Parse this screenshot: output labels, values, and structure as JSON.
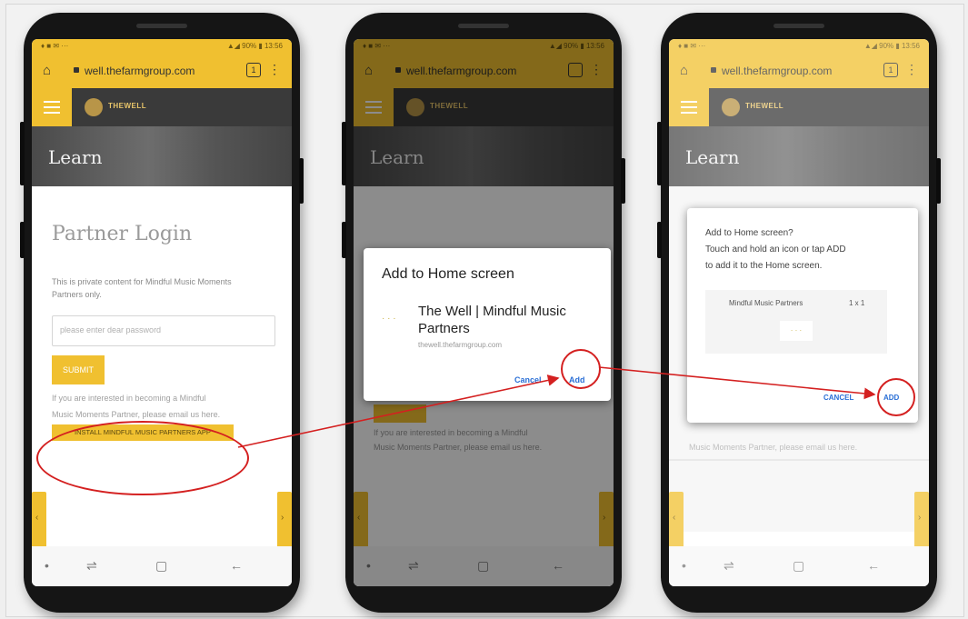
{
  "phones": [
    {
      "status_left": "♦ ■ ✉ ···",
      "status_right": "▲◢ 90% ▮ 13:56",
      "url": "well.thefarmgroup.com",
      "tab_count": "1",
      "brand": "THEWELL",
      "hero_title": "Learn",
      "login": {
        "title": "Partner Login",
        "description": "This is private content for Mindful Music Moments Partners only.",
        "password_placeholder": "please enter dear password",
        "submit": "SUBMIT",
        "info_line1": "If you are interested in becoming a Mindful",
        "info_line2": "Music Moments Partner, please email us here.",
        "install_button": "INSTALL MINDFUL MUSIC PARTNERS APP"
      }
    },
    {
      "status_left": "♦ ■ ✉ ···",
      "status_right": "▲◢ 90% ▮ 13:56",
      "url": "well.thefarmgroup.com",
      "brand": "THEWELL",
      "hero_title": "Learn",
      "dialog": {
        "title": "Add to Home screen",
        "app_name": "The Well | Mindful Music Partners",
        "app_url": "thewell.thefarmgroup.com",
        "cancel": "Cancel",
        "add": "Add"
      },
      "info_line1": "If you are interested in becoming a Mindful",
      "info_line2": "Music Moments Partner, please email us here."
    },
    {
      "status_left": "♦ ■ ✉ ···",
      "status_right": "▲◢ 90% ▮ 13:56",
      "url": "well.thefarmgroup.com",
      "tab_count": "1",
      "brand": "THEWELL",
      "hero_title": "Learn",
      "dialog": {
        "text_line1": "Add to Home screen?",
        "text_line2": "Touch and hold an icon or tap ADD",
        "text_line3": "to add it to the Home screen.",
        "widget_name": "Mindful Music Partners",
        "widget_size": "1 x 1",
        "cancel": "CANCEL",
        "add": "ADD"
      },
      "info_line": "Music Moments Partner, please email us here."
    }
  ],
  "navbar": {
    "dot": "•",
    "recent": "⇌",
    "home": "▢",
    "back": "←"
  },
  "colors": {
    "accent_yellow": "#f0c030",
    "annotation_red": "#d42020",
    "site_dark": "#3a3a3a"
  },
  "icons": {
    "home": "home-icon",
    "lock": "lock-icon",
    "menu": "hamburger-menu-icon",
    "overflow": "more-vert-icon",
    "side_arrow": "chevron-icon"
  }
}
